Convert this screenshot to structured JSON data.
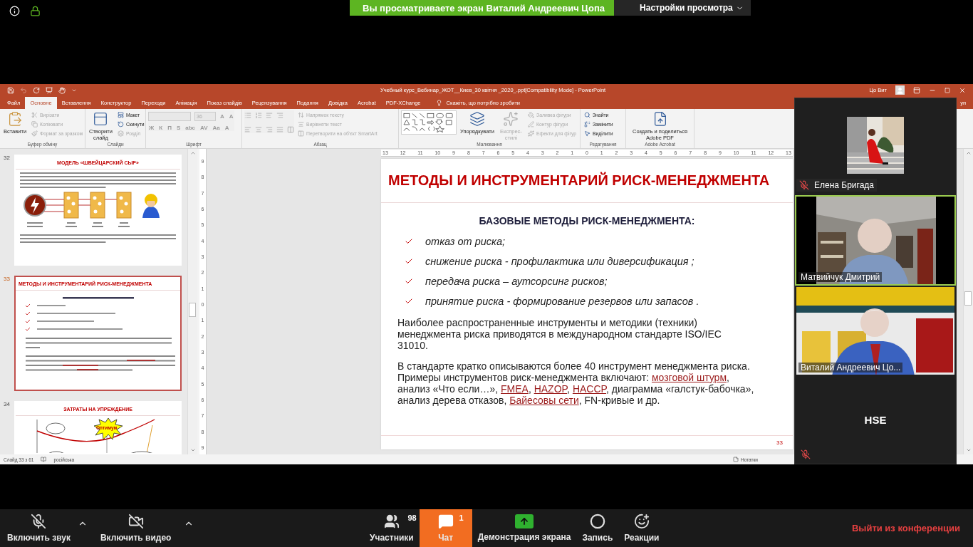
{
  "top_bar": {
    "sharing_banner": "Вы просматриваете экран Виталий  Андреевич Цопа",
    "view_options": "Настройки просмотра"
  },
  "powerpoint": {
    "title": "Учебный курс_Вебинар_ЖОТ__Киев_30 квітня _2020_.ppt[Compatibility Mode]  -  PowerPoint",
    "user": "Цо Вит",
    "tabs": [
      {
        "label": "Файл",
        "selected": false
      },
      {
        "label": "Основне",
        "selected": true
      },
      {
        "label": "Вставлення",
        "selected": false
      },
      {
        "label": "Конструктор",
        "selected": false
      },
      {
        "label": "Переходи",
        "selected": false
      },
      {
        "label": "Анімація",
        "selected": false
      },
      {
        "label": "Показ слайдів",
        "selected": false
      },
      {
        "label": "Рецензування",
        "selected": false
      },
      {
        "label": "Подання",
        "selected": false
      },
      {
        "label": "Довідка",
        "selected": false
      },
      {
        "label": "Acrobat",
        "selected": false
      },
      {
        "label": "PDF-XChange",
        "selected": false
      }
    ],
    "tell_me": "Скажіть, що потрібно зробити",
    "share_partial": "уп",
    "ribbon": [
      {
        "label": "Буфер обміну",
        "items": [
          {
            "kind": "large",
            "label": "Вставити",
            "disabled": false
          },
          {
            "kind": "small",
            "label": "Вирізати",
            "disabled": true
          },
          {
            "kind": "small",
            "label": "Копіювати",
            "disabled": true
          },
          {
            "kind": "small",
            "label": "Формат за зразком",
            "disabled": true
          }
        ]
      },
      {
        "label": "Слайди",
        "items": [
          {
            "kind": "large",
            "label": "Створити слайд",
            "disabled": false
          },
          {
            "kind": "small",
            "label": "Макет",
            "disabled": false
          },
          {
            "kind": "small",
            "label": "Скинути",
            "disabled": false
          },
          {
            "kind": "small",
            "label": "Розділ",
            "disabled": true
          }
        ]
      },
      {
        "label": "Шрифт",
        "items": [
          {
            "kind": "font",
            "size": "36",
            "grow": "A",
            "shrink": "A",
            "glyphs": [
              "Ж",
              "К",
              "П",
              "S",
              "abc",
              "AV",
              "Aa",
              "A"
            ],
            "disabled": true
          }
        ]
      },
      {
        "label": "Абзац",
        "items": [
          {
            "kind": "align_tools",
            "disabled": true
          },
          {
            "kind": "small",
            "label": "Напрямок тексту",
            "disabled": true
          },
          {
            "kind": "small",
            "label": "Вирівняти текст",
            "disabled": true
          },
          {
            "kind": "small",
            "label": "Перетворити на об'єкт SmartArt",
            "disabled": true
          }
        ]
      },
      {
        "label": "Малювання",
        "items": [
          {
            "kind": "shapes",
            "disabled": false
          },
          {
            "kind": "large",
            "label": "Упорядкувати",
            "disabled": false
          },
          {
            "kind": "large",
            "label": "Експрес-стилі",
            "disabled": true
          },
          {
            "kind": "small",
            "label": "Заливка фігури",
            "disabled": true
          },
          {
            "kind": "small",
            "label": "Контур фігури",
            "disabled": true
          },
          {
            "kind": "small",
            "label": "Ефекти для фігур",
            "disabled": true
          }
        ]
      },
      {
        "label": "Редагування",
        "items": [
          {
            "kind": "small",
            "label": "Знайти",
            "disabled": false
          },
          {
            "kind": "small",
            "label": "Замінити",
            "disabled": false
          },
          {
            "kind": "small",
            "label": "Виділити",
            "disabled": false
          }
        ]
      },
      {
        "label": "Adobe Acrobat",
        "items": [
          {
            "kind": "large",
            "label": "Создать и поделиться Adobe PDF",
            "disabled": false
          }
        ]
      }
    ],
    "hruler": [
      "13",
      "12",
      "11",
      "10",
      "9",
      "8",
      "7",
      "6",
      "5",
      "4",
      "3",
      "2",
      "1",
      "0",
      "1",
      "2",
      "3",
      "4",
      "5",
      "6",
      "7",
      "8",
      "9",
      "10",
      "11",
      "12",
      "13"
    ],
    "vruler": [
      "9",
      "8",
      "7",
      "6",
      "5",
      "4",
      "3",
      "2",
      "1",
      "0",
      "1",
      "2",
      "3",
      "4",
      "5",
      "6",
      "7",
      "8",
      "9"
    ],
    "thumbnails": [
      {
        "number": "32",
        "selected": false,
        "kind": "swiss_cheese",
        "title": "МОДЕЛЬ «ШВЕЙЦАРСКИЙ СЫР»"
      },
      {
        "number": "33",
        "selected": true,
        "kind": "slide",
        "title": "МЕТОДЫ И ИНСТРУМЕНТАРИЙ РИСК-МЕНЕДЖМЕНТА"
      },
      {
        "number": "34",
        "selected": false,
        "kind": "cost_chart",
        "title": "ЗАТРАТЫ НА УПРЕЖДЕНИЕ",
        "label": "Оптимум"
      }
    ],
    "slide": {
      "title": "МЕТОДЫ И ИНСТРУМЕНТАРИЙ РИСК-МЕНЕДЖМЕНТА",
      "subtitle": "БАЗОВЫЕ МЕТОДЫ РИСК-МЕНЕДЖМЕНТА:",
      "bullets": [
        "отказ от риска;",
        "снижение риска - профилактика или диверсификация ;",
        "передача риска – аутсорсинг рисков;",
        "принятие риска - формирование резервов или запасов ."
      ],
      "paragraphs": [
        [
          {
            "kind": "text",
            "text": "Наиболее распространенные инструменты и методики (техники) менеджмента риска приводятся в международном стандарте ISO/IEC 31010."
          }
        ],
        [
          {
            "kind": "text",
            "text": "В стандарте кратко описываются более 40 инструмент менеджмента риска. Примеры инструментов риск-менеджмента  включают: "
          },
          {
            "kind": "link",
            "text": "мозговой штурм"
          },
          {
            "kind": "text",
            "text": ", анализ «Что если…», "
          },
          {
            "kind": "link",
            "text": "FMEA"
          },
          {
            "kind": "text",
            "text": ", "
          },
          {
            "kind": "link",
            "text": "HAZOP"
          },
          {
            "kind": "text",
            "text": ", "
          },
          {
            "kind": "link",
            "text": "HACCP"
          },
          {
            "kind": "text",
            "text": ", диаграмма «галстук-бабочка», анализ дерева отказов, "
          },
          {
            "kind": "link",
            "text": "Байесовы сети"
          },
          {
            "kind": "text",
            "text": ", FN-кривые и др."
          }
        ]
      ],
      "page": "33"
    },
    "status": {
      "slide": "Слайд 33 з 61",
      "language": "російська",
      "notes": "Нотатки"
    }
  },
  "participants": [
    {
      "name": "Елена Бригада",
      "muted": true
    },
    {
      "name": "Матвийчук Дмитрий",
      "kind": "video",
      "muted": false,
      "speaking": true
    },
    {
      "name": "Виталий Андреевич Цо...",
      "kind": "video",
      "muted": false,
      "speaking": false
    },
    {
      "name": "HSE",
      "kind": "name_only",
      "muted": true
    }
  ],
  "toolbar": [
    {
      "kind": "audio",
      "label": "Включить звук",
      "muted": true
    },
    {
      "kind": "video",
      "label": "Включить видео",
      "muted": true
    },
    {
      "kind": "participants",
      "label": "Участники",
      "count": "98",
      "selected": false
    },
    {
      "kind": "chat",
      "label": "Чат",
      "count": "1",
      "selected": true
    },
    {
      "kind": "share",
      "label": "Демонстрация экрана",
      "selected": false
    },
    {
      "kind": "record",
      "label": "Запись",
      "selected": false
    },
    {
      "kind": "reactions",
      "label": "Реакции",
      "selected": false
    }
  ],
  "leave": "Выйти из конференции"
}
